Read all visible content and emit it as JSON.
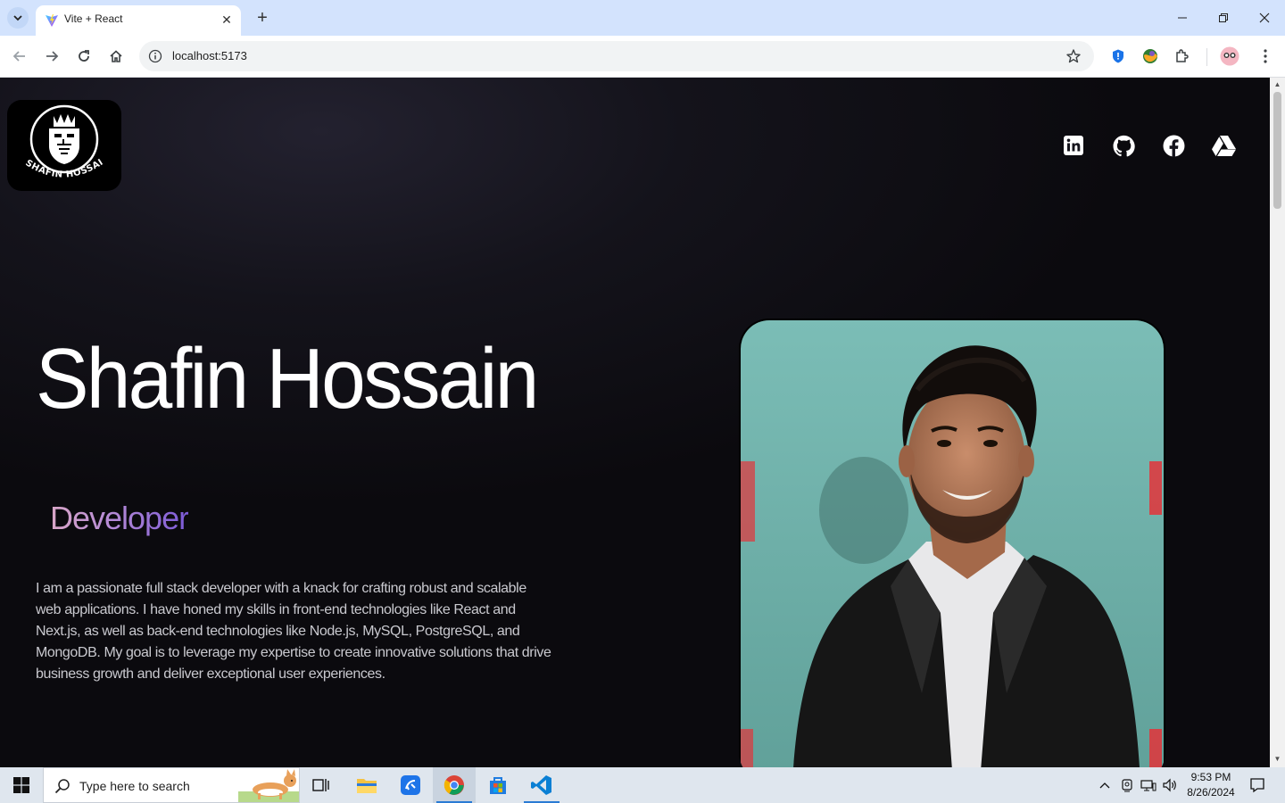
{
  "browser": {
    "tab_title": "Vite + React",
    "url": "localhost:5173",
    "icons": [
      "tab-search-icon",
      "vite-favicon",
      "close-icon",
      "plus-icon",
      "minimize-icon",
      "restore-icon",
      "close-window-icon",
      "back-icon",
      "forward-icon",
      "reload-icon",
      "home-icon",
      "site-info-icon",
      "bookmark-star-icon",
      "shield-extension-icon",
      "globe-extension-icon",
      "puzzle-extensions-icon",
      "profile-avatar-icon",
      "kebab-menu-icon"
    ]
  },
  "page": {
    "logo_text": "SHAFIN HOSSAIN",
    "social_links": [
      {
        "name": "LinkedIn",
        "icon": "linkedin-icon"
      },
      {
        "name": "GitHub",
        "icon": "github-icon"
      },
      {
        "name": "Facebook",
        "icon": "facebook-icon"
      },
      {
        "name": "Google Drive",
        "icon": "google-drive-icon"
      }
    ],
    "name": "Shafin Hossain",
    "role": "Developer",
    "bio": "I am a passionate full stack developer with a knack for crafting robust and scalable web applications. I have honed my skills in front-end technologies like React and Next.js, as well as back-end technologies like Node.js, MySQL, PostgreSQL, and MongoDB. My goal is to leverage my expertise to create innovative solutions that drive business growth and deliver exceptional user experiences.",
    "colors": {
      "background": "#0b0a0e",
      "role_gradient_start": "#d9a6c7",
      "role_gradient_end": "#7b5ad6",
      "portrait_bg": "#7fb8b0",
      "portrait_accent": "#e3343a"
    }
  },
  "taskbar": {
    "search_placeholder": "Type here to search",
    "time": "9:53 PM",
    "date": "8/26/2024",
    "apps": [
      "task-view-icon",
      "file-explorer-icon",
      "app-icon",
      "chrome-icon",
      "store-icon",
      "vscode-icon"
    ]
  }
}
